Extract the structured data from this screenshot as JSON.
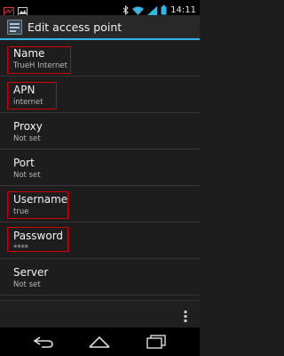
{
  "status_bar": {
    "time": "14:11",
    "icons": [
      "signal-alert-icon",
      "image-icon",
      "bluetooth-icon",
      "wifi-icon",
      "cell-signal-icon",
      "battery-icon"
    ]
  },
  "action_bar": {
    "icon": "settings-app-icon",
    "title": "Edit access point"
  },
  "fields": [
    {
      "title": "Name",
      "value": "TrueH Internet"
    },
    {
      "title": "APN",
      "value": "internet"
    },
    {
      "title": "Proxy",
      "value": "Not set"
    },
    {
      "title": "Port",
      "value": "Not set"
    },
    {
      "title": "Username",
      "value": "true"
    },
    {
      "title": "Password",
      "value": "****"
    },
    {
      "title": "Server",
      "value": "Not set"
    }
  ],
  "menu": {
    "icon": "overflow-menu-icon"
  },
  "nav_bar": {
    "icons": [
      "back-icon",
      "home-icon",
      "recent-apps-icon"
    ]
  },
  "colors": {
    "accent": "#33b5e5",
    "highlight": "#d10000",
    "background": "#1d1d1d"
  }
}
